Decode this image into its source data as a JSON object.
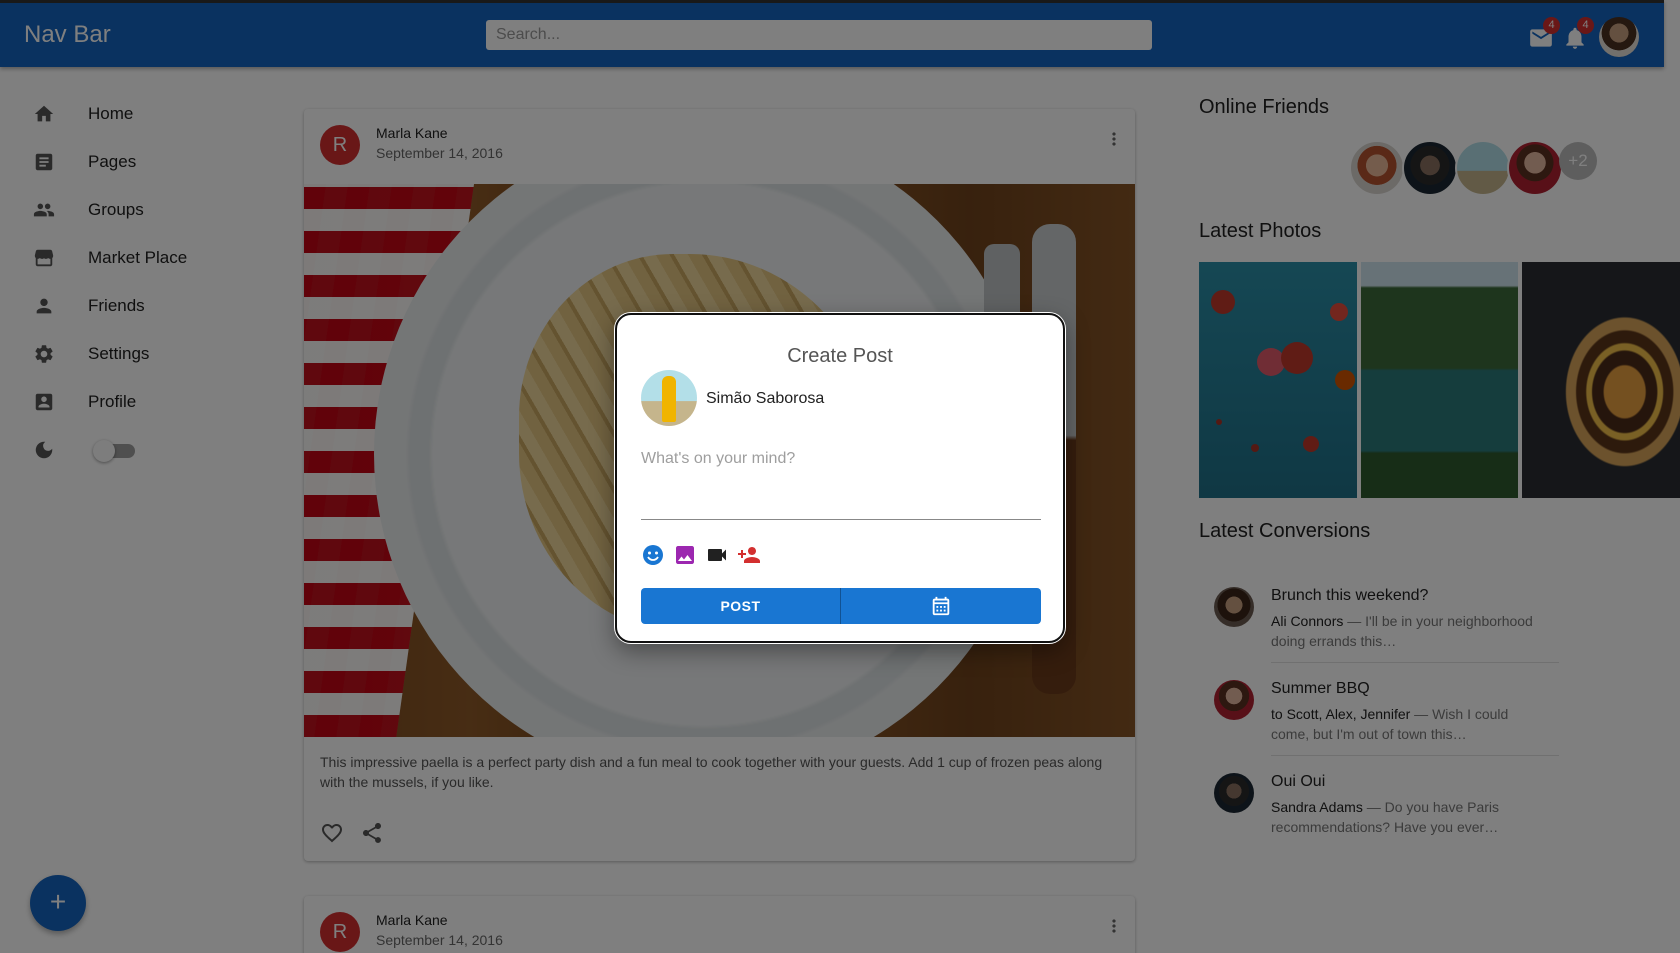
{
  "appbar": {
    "brand": "Nav Bar",
    "search_placeholder": "Search...",
    "mail_badge": "4",
    "notifications_badge": "4"
  },
  "sidebar": {
    "items": [
      {
        "label": "Home",
        "icon": "home-icon"
      },
      {
        "label": "Pages",
        "icon": "pages-icon"
      },
      {
        "label": "Groups",
        "icon": "groups-icon"
      },
      {
        "label": "Market Place",
        "icon": "storefront-icon"
      },
      {
        "label": "Friends",
        "icon": "person-icon"
      },
      {
        "label": "Settings",
        "icon": "gear-icon"
      },
      {
        "label": "Profile",
        "icon": "account-box-icon"
      }
    ],
    "dark_mode_toggle": {
      "icon": "moon-icon",
      "on": false
    },
    "fab_label": "+"
  },
  "feed": {
    "posts": [
      {
        "avatar_letter": "R",
        "author": "Marla Kane",
        "date": "September 14, 2016",
        "text": "This impressive paella is a perfect party dish and a fun meal to cook together with your guests. Add 1 cup of frozen peas along with the mussels, if you like."
      },
      {
        "avatar_letter": "R",
        "author": "Marla Kane",
        "date": "September 14, 2016"
      }
    ]
  },
  "right_panel": {
    "online_friends_title": "Online Friends",
    "online_friends_more": "+2",
    "latest_photos_title": "Latest Photos",
    "latest_conversations_title": "Latest Conversions",
    "conversations": [
      {
        "title": "Brunch this weekend?",
        "sender": "Ali Connors",
        "preview": " — I'll be in your neighborhood doing errands this…"
      },
      {
        "title": "Summer BBQ",
        "sender": "to Scott, Alex, Jennifer",
        "preview": " — Wish I could come, but I'm out of town this…"
      },
      {
        "title": "Oui Oui",
        "sender": "Sandra Adams",
        "preview": " — Do you have Paris recommendations? Have you ever…"
      }
    ]
  },
  "dialog": {
    "title": "Create Post",
    "user_name": "Simão Saborosa",
    "input_placeholder": "What's on your mind?",
    "input_value": "",
    "tools": [
      "emoji-icon",
      "image-icon",
      "video-icon",
      "tag-person-icon"
    ],
    "post_button": "POST",
    "schedule_icon": "calendar-icon"
  },
  "colors": {
    "primary": "#1565c0",
    "button": "#1976d2",
    "badge": "#d32f2f",
    "avatar_red": "#d32f2f"
  }
}
